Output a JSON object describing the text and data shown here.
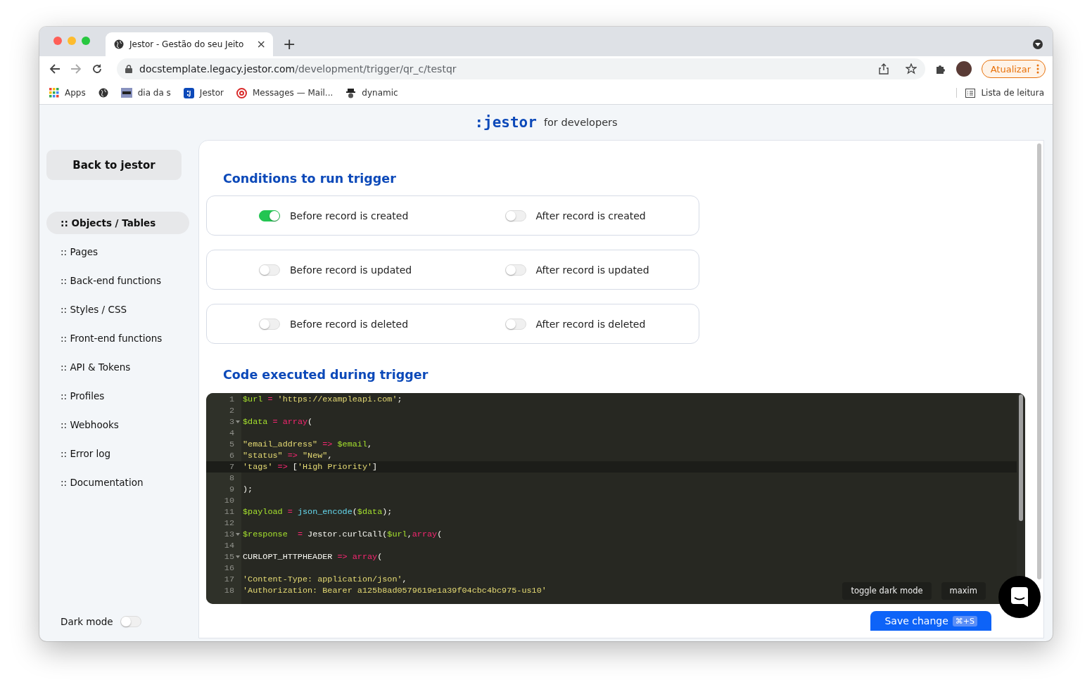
{
  "browser": {
    "tab": {
      "title": "Jestor - Gestão do seu Jeito",
      "close": "×"
    },
    "new_tab": "+",
    "url": {
      "host": "docstemplate.legacy.jestor.com",
      "path": "/development/trigger/qr_c/testqr"
    },
    "update_button": "Atualizar",
    "bookmarks": [
      {
        "kind": "apps",
        "label": "Apps"
      },
      {
        "kind": "globe"
      },
      {
        "kind": "php",
        "label": "dia da s"
      },
      {
        "kind": "jestor",
        "label": "Jestor"
      },
      {
        "kind": "mail",
        "label": "Messages — Mail..."
      },
      {
        "kind": "spy",
        "label": "dynamic"
      }
    ],
    "reading_list": "Lista de leitura"
  },
  "header": {
    "logo": ":jestor",
    "subtitle": "for developers"
  },
  "sidebar": {
    "back_button": "Back to jestor",
    "items": [
      {
        "label": ":: Objects / Tables",
        "selected": true
      },
      {
        "label": ":: Pages",
        "selected": false
      },
      {
        "label": ":: Back-end functions",
        "selected": false
      },
      {
        "label": ":: Styles / CSS",
        "selected": false
      },
      {
        "label": ":: Front-end functions",
        "selected": false
      },
      {
        "label": ":: API & Tokens",
        "selected": false
      },
      {
        "label": ":: Profiles",
        "selected": false
      },
      {
        "label": ":: Webhooks",
        "selected": false
      },
      {
        "label": ":: Error log",
        "selected": false
      },
      {
        "label": ":: Documentation",
        "selected": false
      }
    ],
    "dark_mode": {
      "label": "Dark mode",
      "on": false
    }
  },
  "conditions": {
    "title": "Conditions to run trigger",
    "rows": [
      [
        {
          "label": "Before record is created",
          "on": true
        },
        {
          "label": "After record is created",
          "on": false
        }
      ],
      [
        {
          "label": "Before record is updated",
          "on": false
        },
        {
          "label": "After record is updated",
          "on": false
        }
      ],
      [
        {
          "label": "Before record is deleted",
          "on": false
        },
        {
          "label": "After record is deleted",
          "on": false
        }
      ]
    ]
  },
  "code": {
    "title": "Code executed during trigger",
    "lines": [
      {
        "number": "1",
        "fold": false,
        "active": false,
        "tokens": [
          {
            "kind": "var",
            "text": "$url"
          },
          {
            "kind": "op",
            "text": " = "
          },
          {
            "kind": "str",
            "text": "'https://exampleapi.com'"
          },
          {
            "kind": "plain",
            "text": ";"
          }
        ]
      },
      {
        "number": "2",
        "fold": false,
        "active": false
      },
      {
        "number": "3",
        "fold": true,
        "active": false,
        "tokens": [
          {
            "kind": "var",
            "text": "$data"
          },
          {
            "kind": "op",
            "text": " = "
          },
          {
            "kind": "kw",
            "text": "array"
          },
          {
            "kind": "plain",
            "text": "("
          }
        ]
      },
      {
        "number": "4",
        "fold": false,
        "active": false
      },
      {
        "number": "5",
        "fold": false,
        "active": false,
        "tokens": [
          {
            "kind": "str",
            "text": "\"email_address\""
          },
          {
            "kind": "op",
            "text": " => "
          },
          {
            "kind": "var",
            "text": "$email"
          },
          {
            "kind": "plain",
            "text": ","
          }
        ]
      },
      {
        "number": "6",
        "fold": false,
        "active": false,
        "tokens": [
          {
            "kind": "str",
            "text": "\"status\""
          },
          {
            "kind": "op",
            "text": " => "
          },
          {
            "kind": "str",
            "text": "\"New\""
          },
          {
            "kind": "plain",
            "text": ","
          }
        ]
      },
      {
        "number": "7",
        "fold": false,
        "active": true,
        "tokens": [
          {
            "kind": "str",
            "text": "'tags'"
          },
          {
            "kind": "op",
            "text": " => "
          },
          {
            "kind": "plain",
            "text": "["
          },
          {
            "kind": "str",
            "text": "'High Priority'"
          },
          {
            "kind": "plain",
            "text": "]"
          }
        ]
      },
      {
        "number": "8",
        "fold": false,
        "active": false
      },
      {
        "number": "9",
        "fold": false,
        "active": false,
        "tokens": [
          {
            "kind": "plain",
            "text": ");"
          }
        ]
      },
      {
        "number": "10",
        "fold": false,
        "active": false
      },
      {
        "number": "11",
        "fold": false,
        "active": false,
        "tokens": [
          {
            "kind": "var",
            "text": "$payload"
          },
          {
            "kind": "op",
            "text": " = "
          },
          {
            "kind": "fn",
            "text": "json_encode"
          },
          {
            "kind": "plain",
            "text": "("
          },
          {
            "kind": "var",
            "text": "$data"
          },
          {
            "kind": "plain",
            "text": ");"
          }
        ]
      },
      {
        "number": "12",
        "fold": false,
        "active": false
      },
      {
        "number": "13",
        "fold": true,
        "active": false,
        "tokens": [
          {
            "kind": "var",
            "text": "$response"
          },
          {
            "kind": "op",
            "text": "  = "
          },
          {
            "kind": "plain",
            "text": "Jestor.curlCall("
          },
          {
            "kind": "var",
            "text": "$url"
          },
          {
            "kind": "plain",
            "text": ","
          },
          {
            "kind": "kw",
            "text": "array"
          },
          {
            "kind": "plain",
            "text": "("
          }
        ]
      },
      {
        "number": "14",
        "fold": false,
        "active": false
      },
      {
        "number": "15",
        "fold": true,
        "active": false,
        "tokens": [
          {
            "kind": "plain",
            "text": "CURLOPT_HTTPHEADER"
          },
          {
            "kind": "op",
            "text": " => "
          },
          {
            "kind": "kw",
            "text": "array"
          },
          {
            "kind": "plain",
            "text": "("
          }
        ]
      },
      {
        "number": "16",
        "fold": false,
        "active": false
      },
      {
        "number": "17",
        "fold": false,
        "active": false,
        "tokens": [
          {
            "kind": "str",
            "text": "'Content-Type: application/json'"
          },
          {
            "kind": "plain",
            "text": ","
          }
        ]
      },
      {
        "number": "18",
        "fold": false,
        "active": false,
        "tokens": [
          {
            "kind": "str",
            "text": "'Authorization: Bearer a125b8ad0579619e1a39f04cbc4bc975-us10'"
          }
        ]
      }
    ],
    "toggle_dark_button": "toggle dark mode",
    "maximize_button": "maxim"
  },
  "save_button": {
    "label": "Save change",
    "shortcut": "⌘+S"
  }
}
